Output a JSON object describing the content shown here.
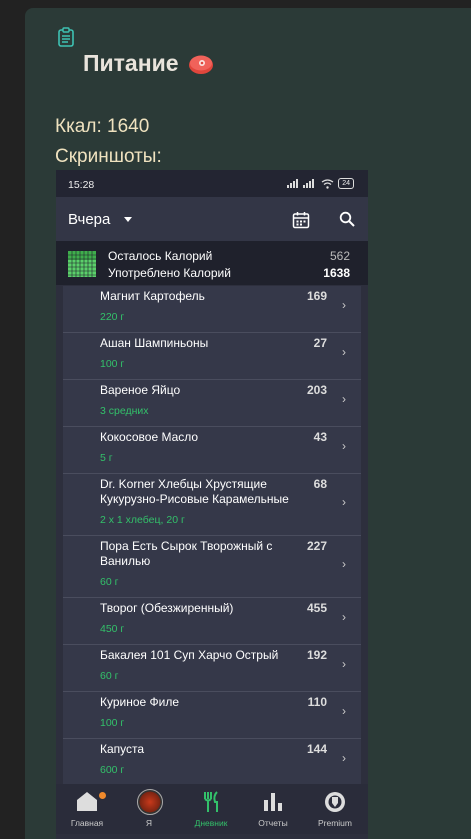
{
  "header": {
    "title": "Питание"
  },
  "info": {
    "kcal": "Ккал: 1640",
    "screenshots_label": "Скриншоты:"
  },
  "phone": {
    "status": {
      "time": "15:28",
      "battery": "24"
    },
    "topbar": {
      "day": "Вчера"
    },
    "summary": {
      "remaining_label": "Осталось Калорий",
      "remaining_value": "562",
      "consumed_label": "Употреблено Калорий",
      "consumed_value": "1638"
    },
    "items": [
      {
        "name": "Магнит Картофель",
        "amount": "220 г",
        "calories": "169"
      },
      {
        "name": "Ашан Шампиньоны",
        "amount": "100 г",
        "calories": "27"
      },
      {
        "name": "Вареное Яйцо",
        "amount": "3 средних",
        "calories": "203"
      },
      {
        "name": "Кокосовое Масло",
        "amount": "5 г",
        "calories": "43"
      },
      {
        "name": "Dr. Korner Хлебцы Хрустящие Кукурузно-Рисовые Карамельные",
        "amount": "2 x 1 хлебец, 20 г",
        "calories": "68"
      },
      {
        "name": "Пора Есть Сырок Творожный с Ванилью",
        "amount": "60 г",
        "calories": "227"
      },
      {
        "name": "Творог (Обезжиренный)",
        "amount": "450 г",
        "calories": "455"
      },
      {
        "name": "Бакалея 101 Суп Харчо Острый",
        "amount": "60 г",
        "calories": "192"
      },
      {
        "name": "Куриное Филе",
        "amount": "100 г",
        "calories": "110"
      },
      {
        "name": "Капуста",
        "amount": "600 г",
        "calories": "144"
      }
    ],
    "nav": [
      {
        "label": "Главная",
        "icon": "home-icon"
      },
      {
        "label": "Я",
        "icon": "avatar"
      },
      {
        "label": "Дневник",
        "icon": "fork-knife-icon"
      },
      {
        "label": "Отчеты",
        "icon": "bar-chart-icon"
      },
      {
        "label": "Premium",
        "icon": "premium-icon"
      }
    ]
  },
  "colors": {
    "background": "#222222",
    "card": "#2b3a37",
    "accent_green": "#33c06a",
    "text_cream": "#efe2bf"
  }
}
